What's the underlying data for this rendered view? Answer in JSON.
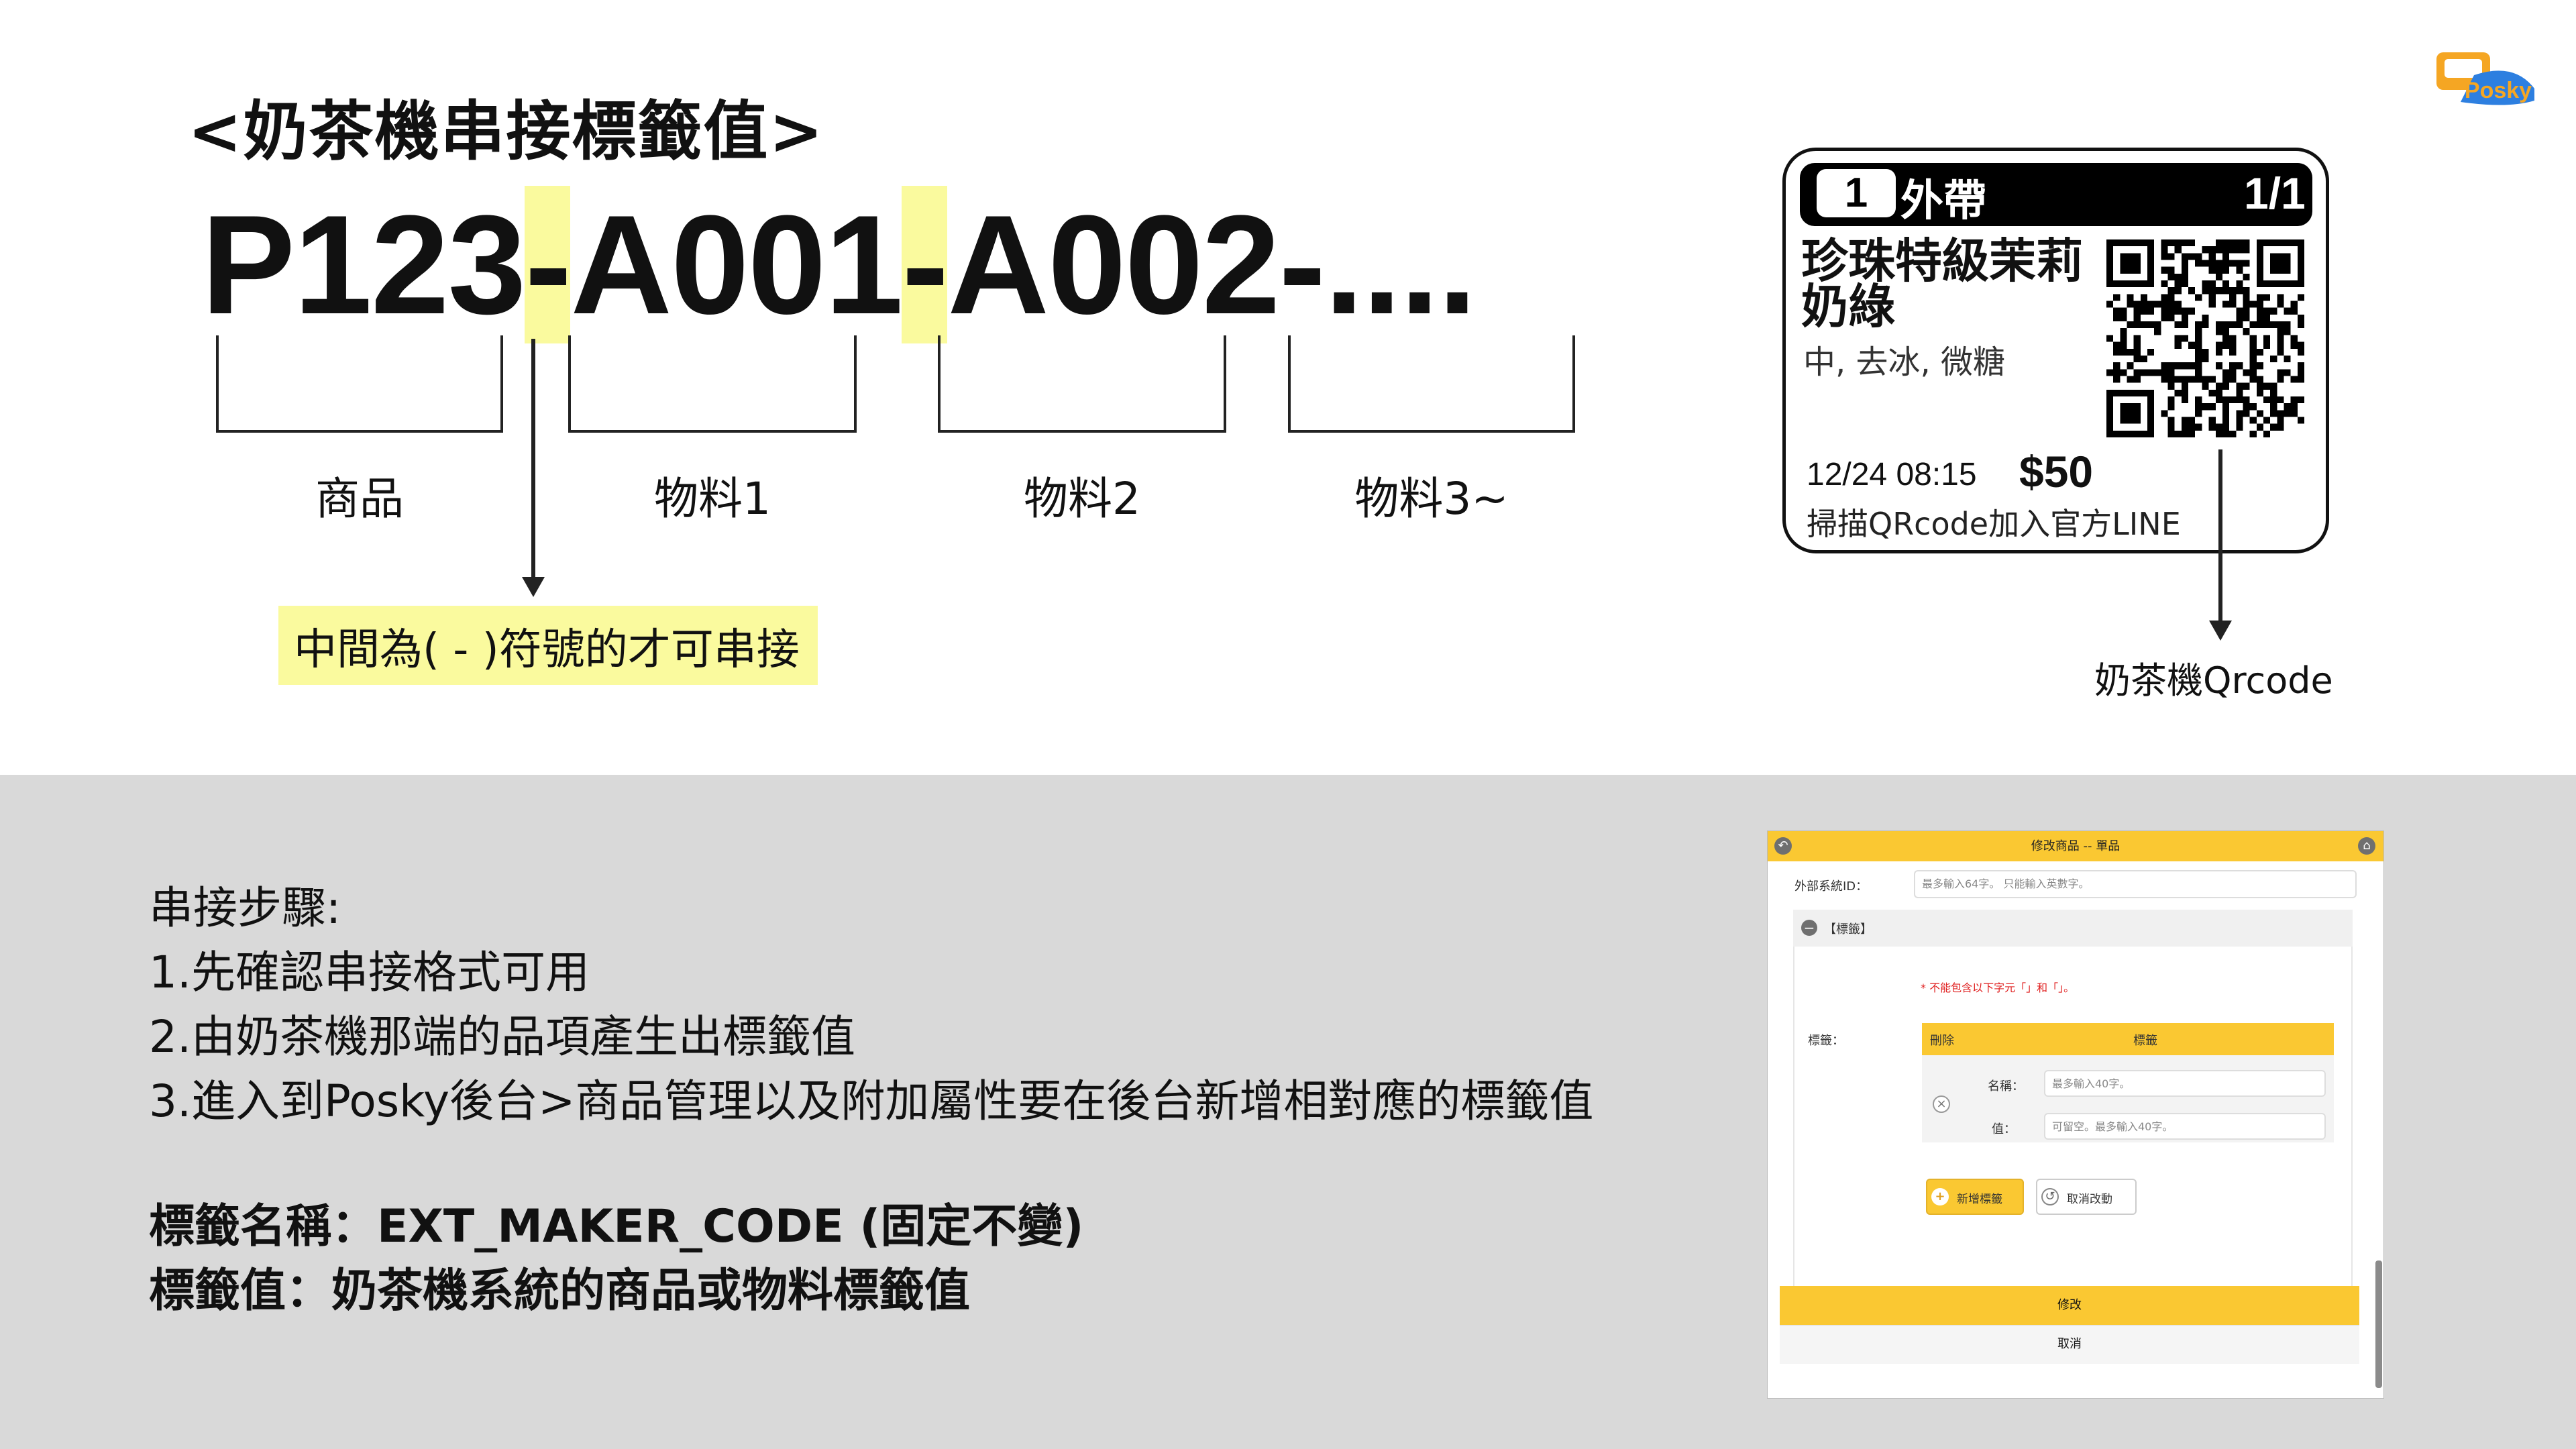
{
  "header": {
    "title": "<奶茶機串接標籤值>"
  },
  "code": {
    "part1": "P123",
    "dash1": "-",
    "part2": "A001",
    "dash2": "-",
    "part3": "A002-...."
  },
  "segments": [
    {
      "label": "商品"
    },
    {
      "label": "物料1"
    },
    {
      "label": "物料2"
    },
    {
      "label": "物料3~"
    }
  ],
  "note": "中間為( - )符號的才可串接",
  "receipt": {
    "number": "1",
    "type": "外帶",
    "page": "1/1",
    "item_name": "珍珠特級茉莉奶綠",
    "options": "中, 去冰, 微糖",
    "time": "12/24  08:15",
    "price": "$50",
    "scan_text": "掃描QRcode加入官方LINE"
  },
  "qr_label": "奶茶機Qrcode",
  "logo": {
    "text": "Posky",
    "icon": "posky-logo-icon"
  },
  "steps": {
    "heading": "串接步驟:",
    "items": [
      "1.先確認串接格式可用",
      "2.由奶茶機那端的品項產生出標籤值",
      "3.進入到Posky後台>商品管理以及附加屬性要在後台新增相對應的標籤值"
    ]
  },
  "tag_info": {
    "name_line": "標籤名稱：EXT_MAKER_CODE (固定不變)",
    "value_line": "標籤值：奶茶機系統的商品或物料標籤值"
  },
  "form": {
    "title": "修改商品 -- 單品",
    "back_icon": "back-icon",
    "home_icon": "home-icon",
    "ext_id_label": "外部系統ID：",
    "ext_id_placeholder": "最多輸入64字。 只能輸入英數字。",
    "section_title": "【標籤】",
    "warning": "* 不能包含以下字元「」和「」。",
    "tag_label": "標籤：",
    "col_delete": "刪除",
    "col_tag": "標籤",
    "name_label": "名稱：",
    "name_placeholder": "最多輸入40字。",
    "value_label": "值：",
    "value_placeholder": "可留空。最多輸入40字。",
    "add_button": "新增標籤",
    "cancel_changes_button": "取消改動",
    "submit_button": "修改",
    "cancel_button": "取消"
  },
  "colors": {
    "accent": "#fac832",
    "highlight": "#fafa9e",
    "bottom_bg": "#d9d9d9"
  }
}
